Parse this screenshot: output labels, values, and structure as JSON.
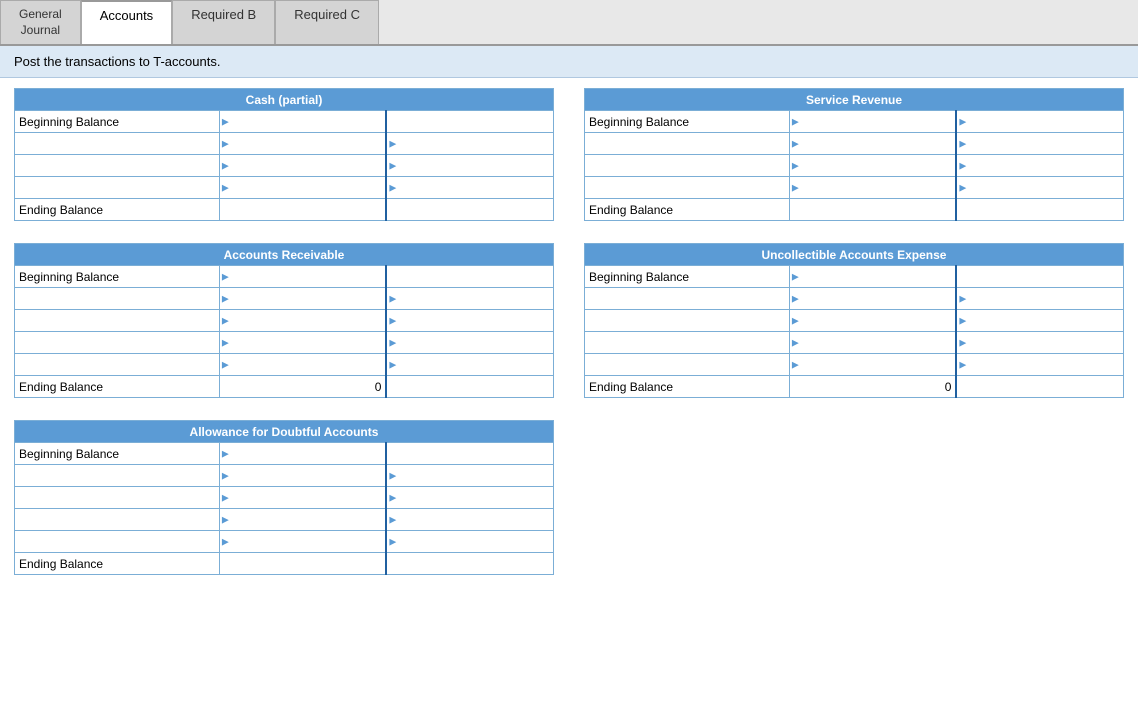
{
  "tabs": [
    {
      "id": "general-journal",
      "label": "General\nJournal",
      "active": false
    },
    {
      "id": "accounts",
      "label": "Accounts",
      "active": true
    },
    {
      "id": "required-b",
      "label": "Required B",
      "active": false
    },
    {
      "id": "required-c",
      "label": "Required C",
      "active": false
    }
  ],
  "instruction": "Post the transactions to T-accounts.",
  "accounts": [
    {
      "id": "cash",
      "title": "Cash (partial)",
      "position": "left",
      "rows": [
        {
          "label": "Beginning Balance",
          "hasArrow": true,
          "col2": "",
          "col3": ""
        },
        {
          "label": "",
          "hasArrow": true,
          "col2": "",
          "col3": ""
        },
        {
          "label": "",
          "hasArrow": true,
          "col2": "",
          "col3": ""
        },
        {
          "label": "",
          "hasArrow": true,
          "col2": "",
          "col3": ""
        },
        {
          "label": "Ending Balance",
          "hasArrow": false,
          "col2": "",
          "col3": ""
        }
      ]
    },
    {
      "id": "service-revenue",
      "title": "Service Revenue",
      "position": "right",
      "rows": [
        {
          "label": "Beginning Balance",
          "hasArrow": true,
          "col2": "",
          "col3": ""
        },
        {
          "label": "",
          "hasArrow": true,
          "col2": "",
          "col3": ""
        },
        {
          "label": "",
          "hasArrow": true,
          "col2": "",
          "col3": ""
        },
        {
          "label": "",
          "hasArrow": true,
          "col2": "",
          "col3": ""
        },
        {
          "label": "Ending Balance",
          "hasArrow": false,
          "col2": "",
          "col3": ""
        }
      ]
    },
    {
      "id": "accounts-receivable",
      "title": "Accounts Receivable",
      "position": "left",
      "rows": [
        {
          "label": "Beginning Balance",
          "hasArrow": true,
          "col2": "",
          "col3": ""
        },
        {
          "label": "",
          "hasArrow": true,
          "col2": "",
          "col3": ""
        },
        {
          "label": "",
          "hasArrow": true,
          "col2": "",
          "col3": ""
        },
        {
          "label": "",
          "hasArrow": true,
          "col2": "",
          "col3": ""
        },
        {
          "label": "",
          "hasArrow": true,
          "col2": "",
          "col3": ""
        },
        {
          "label": "Ending Balance",
          "hasArrow": false,
          "col2": "0",
          "col3": ""
        }
      ]
    },
    {
      "id": "uncollectible-accounts-expense",
      "title": "Uncollectible Accounts Expense",
      "position": "right",
      "rows": [
        {
          "label": "Beginning Balance",
          "hasArrow": true,
          "col2": "",
          "col3": ""
        },
        {
          "label": "",
          "hasArrow": true,
          "col2": "",
          "col3": ""
        },
        {
          "label": "",
          "hasArrow": true,
          "col2": "",
          "col3": ""
        },
        {
          "label": "",
          "hasArrow": true,
          "col2": "",
          "col3": ""
        },
        {
          "label": "",
          "hasArrow": true,
          "col2": "",
          "col3": ""
        },
        {
          "label": "Ending Balance",
          "hasArrow": false,
          "col2": "0",
          "col3": ""
        }
      ]
    },
    {
      "id": "allowance-doubtful",
      "title": "Allowance for Doubtful Accounts",
      "position": "left-only",
      "rows": [
        {
          "label": "Beginning Balance",
          "hasArrow": true,
          "col2": "",
          "col3": ""
        },
        {
          "label": "",
          "hasArrow": true,
          "col2": "",
          "col3": ""
        },
        {
          "label": "",
          "hasArrow": true,
          "col2": "",
          "col3": ""
        },
        {
          "label": "",
          "hasArrow": true,
          "col2": "",
          "col3": ""
        },
        {
          "label": "",
          "hasArrow": true,
          "col2": "",
          "col3": ""
        },
        {
          "label": "Ending Balance",
          "hasArrow": false,
          "col2": "",
          "col3": ""
        }
      ]
    }
  ]
}
